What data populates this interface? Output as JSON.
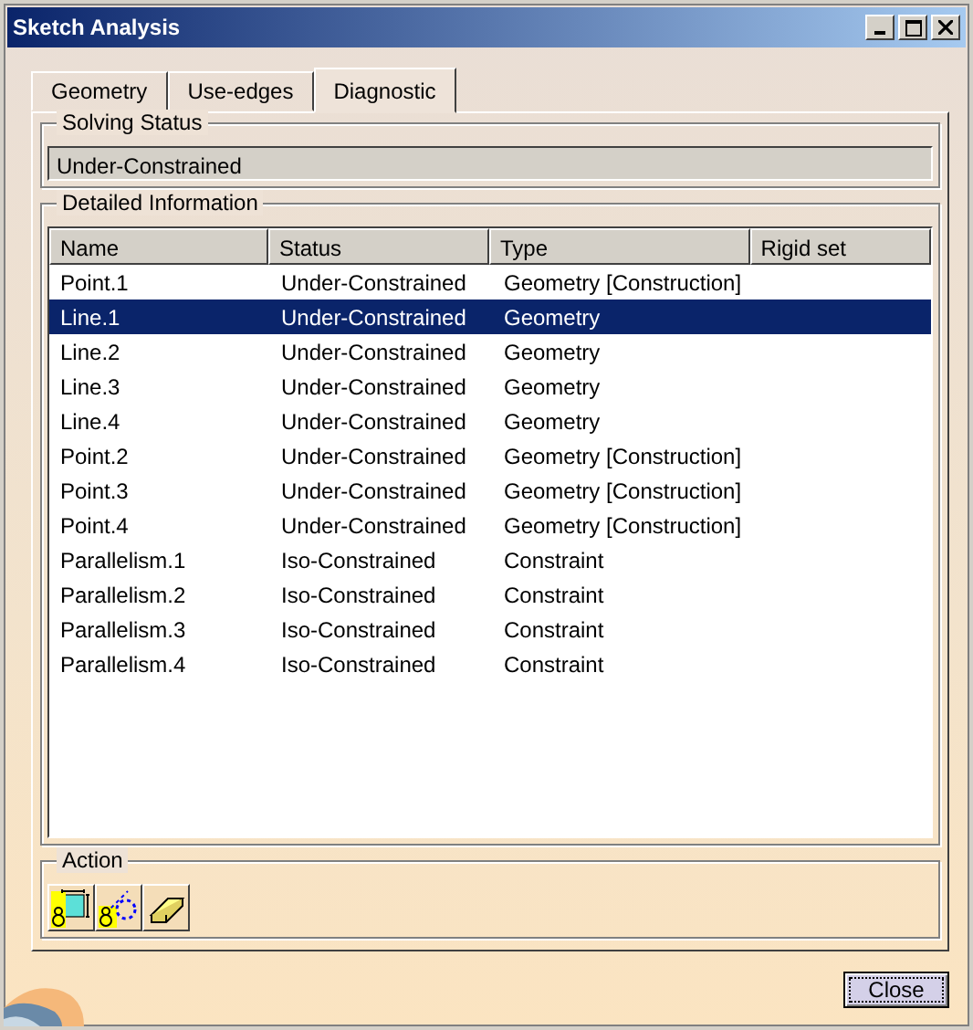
{
  "window": {
    "title": "Sketch Analysis",
    "controls": [
      {
        "kind": "minimize"
      },
      {
        "kind": "maximize"
      },
      {
        "kind": "close"
      }
    ]
  },
  "tabs": [
    {
      "label": "Geometry",
      "selected": false
    },
    {
      "label": "Use-edges",
      "selected": false
    },
    {
      "label": "Diagnostic",
      "selected": true
    }
  ],
  "solving_status": {
    "title": "Solving Status",
    "value": "Under-Constrained"
  },
  "detailed_information": {
    "title": "Detailed Information",
    "columns": [
      "Name",
      "Status",
      "Type",
      "Rigid set"
    ],
    "rows": [
      {
        "name": "Point.1",
        "status": "Under-Constrained",
        "type": "Geometry [Construction]",
        "selected": false
      },
      {
        "name": "Line.1",
        "status": "Under-Constrained",
        "type": "Geometry",
        "selected": true
      },
      {
        "name": "Line.2",
        "status": "Under-Constrained",
        "type": "Geometry",
        "selected": false
      },
      {
        "name": "Line.3",
        "status": "Under-Constrained",
        "type": "Geometry",
        "selected": false
      },
      {
        "name": "Line.4",
        "status": "Under-Constrained",
        "type": "Geometry",
        "selected": false
      },
      {
        "name": "Point.2",
        "status": "Under-Constrained",
        "type": "Geometry [Construction]",
        "selected": false
      },
      {
        "name": "Point.3",
        "status": "Under-Constrained",
        "type": "Geometry [Construction]",
        "selected": false
      },
      {
        "name": "Point.4",
        "status": "Under-Constrained",
        "type": "Geometry [Construction]",
        "selected": false
      },
      {
        "name": "Parallelism.1",
        "status": "Iso-Constrained",
        "type": "Constraint",
        "selected": false
      },
      {
        "name": "Parallelism.2",
        "status": "Iso-Constrained",
        "type": "Constraint",
        "selected": false
      },
      {
        "name": "Parallelism.3",
        "status": "Iso-Constrained",
        "type": "Constraint",
        "selected": false
      },
      {
        "name": "Parallelism.4",
        "status": "Iso-Constrained",
        "type": "Constraint",
        "selected": false
      }
    ]
  },
  "action": {
    "title": "Action",
    "tools": [
      {
        "kind": "dimension"
      },
      {
        "kind": "construction"
      },
      {
        "kind": "erase"
      }
    ]
  },
  "buttons": [
    "Close"
  ]
}
